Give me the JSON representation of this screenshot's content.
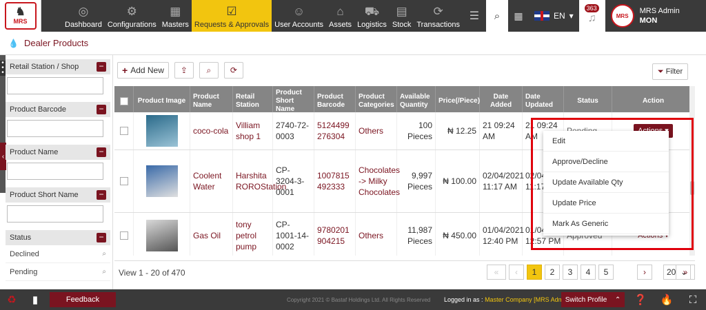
{
  "logo": {
    "text": "MRS"
  },
  "nav": [
    {
      "label": "Dashboard",
      "icon": "gauge-icon",
      "glyph": "◎"
    },
    {
      "label": "Configurations",
      "icon": "gears-icon",
      "glyph": "⚙"
    },
    {
      "label": "Masters",
      "icon": "building-icon",
      "glyph": "▦"
    },
    {
      "label": "Requests & Approvals",
      "icon": "clipboard-icon",
      "glyph": "☑"
    },
    {
      "label": "User Accounts",
      "icon": "users-icon",
      "glyph": "☺"
    },
    {
      "label": "Assets",
      "icon": "factory-icon",
      "glyph": "⌂"
    },
    {
      "label": "Logistics",
      "icon": "truck-icon",
      "glyph": "⛟"
    },
    {
      "label": "Stock",
      "icon": "stack-icon",
      "glyph": "▤"
    },
    {
      "label": "Transactions",
      "icon": "exchange-icon",
      "glyph": "⟳"
    }
  ],
  "header": {
    "lang": "EN",
    "notif_count": "363",
    "user_name": "MRS Admin",
    "user_role": "MON"
  },
  "breadcrumb": {
    "title": "Dealer Products"
  },
  "sidebar": {
    "filters": [
      "Retail Station / Shop",
      "Product Barcode",
      "Product Name",
      "Product Short Name"
    ],
    "status_label": "Status",
    "status_options": [
      "Declined",
      "Pending"
    ]
  },
  "toolbar": {
    "add_label": "Add New",
    "filter_label": "Filter"
  },
  "table": {
    "headers": [
      "",
      "Product Image",
      "Product Name",
      "Retail Station",
      "Product Short Name",
      "Product Barcode",
      "Product Categories",
      "Available Quantity",
      "Price(/Piece)",
      "Date Added",
      "Date Updated",
      "Status",
      "Action"
    ],
    "rows": [
      {
        "name": "coco-cola",
        "station": "Villiam shop 1",
        "short": "2740-72-0003",
        "barcode": "5124499 276304",
        "category": "Others",
        "qty": "100 Pieces",
        "price": "₦ 12.25",
        "added": "21 09:24 AM",
        "updated": "21 09:24 AM",
        "status": "Pending",
        "action": "Actions ▾"
      },
      {
        "name": "Coolent Water",
        "station": "Harshita ROROStation",
        "short": "CP-3204-3-0001",
        "barcode": "1007815 492333",
        "category": "Chocolates -> Milky Chocolates",
        "qty": "9,997 Pieces",
        "price": "₦ 100.00",
        "added": "02/04/2021 11:17 AM",
        "updated": "02/04/2021 11:17 AM",
        "status": "",
        "action": ""
      },
      {
        "name": "Gas Oil",
        "station": "tony petrol pump",
        "short": "CP-1001-14-0002",
        "barcode": "9780201 904215",
        "category": "Others",
        "qty": "11,987 Pieces",
        "price": "₦ 450.00",
        "added": "01/04/2021 12:40 PM",
        "updated": "01/04/2021 12:57 PM",
        "status": "Approved",
        "action": "Actions ▾"
      }
    ]
  },
  "dropdown": [
    "Edit",
    "Approve/Decline",
    "Update Available Qty",
    "Update Price",
    "Mark As Generic"
  ],
  "pager": {
    "view_text": "View 1 - 20 of 470",
    "pages": [
      "1",
      "2",
      "3",
      "4",
      "5"
    ],
    "per_page": "20"
  },
  "footer": {
    "feedback": "Feedback",
    "copyright": "Copyright 2021 © Bastaf Holdings Ltd. All Rights Reserved",
    "logged_prefix": "Logged in as :",
    "logged_value": "Master Company [MRS Admin]",
    "switch_profile": "Switch Profile"
  }
}
